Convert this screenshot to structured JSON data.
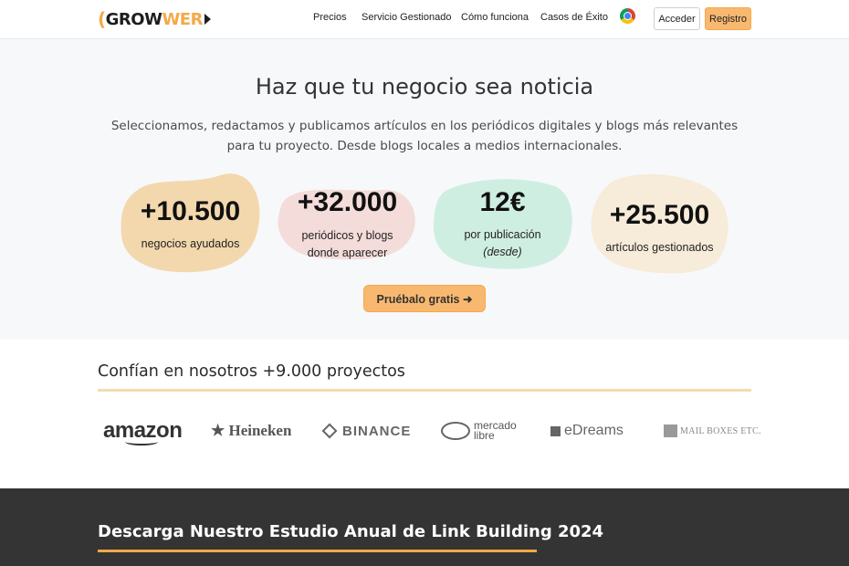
{
  "nav": {
    "logo_text": "GROWWER",
    "links": [
      "Precios",
      "Servicio Gestionado",
      "Cómo funciona",
      "Casos de Éxito"
    ],
    "login": "Acceder",
    "register": "Registro"
  },
  "hero": {
    "title": "Haz que tu negocio sea noticia",
    "subtitle": "Seleccionamos, redactamos y publicamos artículos en los periódicos digitales y blogs más relevantes para tu proyecto. Desde blogs locales a medios internacionales.",
    "stats": [
      {
        "value": "+10.500",
        "label": "negocios ayudados",
        "color": "#f3d8ad"
      },
      {
        "value": "+32.000",
        "label": "periódicos y blogs",
        "label2": "donde aparecer",
        "color": "#f3dcd9"
      },
      {
        "value": "12€",
        "label": "por publicación",
        "label2": "(desde)",
        "color": "#cfeee2"
      },
      {
        "value": "+25.500",
        "label": "artículos gestionados",
        "color": "#f7ebd9"
      }
    ],
    "cta": "Pruébalo gratis ➜"
  },
  "trust": {
    "title": "Confían en nosotros +9.000 proyectos",
    "brands": {
      "amazon": "amazon",
      "heineken": "★ Heineken",
      "binance": "BINANCE",
      "mercado_1": "mercado",
      "mercado_2": "libre",
      "edreams": "eDreams",
      "mbe": "MAIL BOXES ETC."
    }
  },
  "study": {
    "title": "Descarga Nuestro Estudio Anual de Link Building 2024"
  },
  "colors": {
    "accent": "#f9b870",
    "dark_bg": "#343434"
  }
}
